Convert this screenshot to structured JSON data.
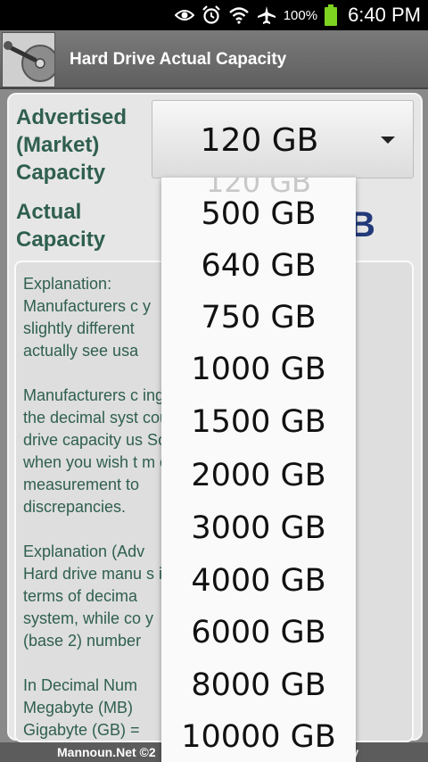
{
  "status_bar": {
    "battery_percent": "100%",
    "time": "6:40 PM",
    "icons": [
      "eye-icon",
      "alarm-icon",
      "wifi-icon",
      "airplane-icon",
      "battery-icon"
    ]
  },
  "app": {
    "title": "Hard Drive Actual Capacity"
  },
  "form": {
    "advertised_label": "Advertised\n(Market)\nCapacity",
    "actual_label": "Actual\nCapacity",
    "selected_capacity": "120 GB",
    "result_partial": "B"
  },
  "explanation": {
    "paragraphs": [
      "Explanation:\n Manufacturers c                    y\nslightly different                    \nactually see usa",
      "Manufacturers c                       ing\nthe decimal syst                      count\ndrive capacity us                      So,\nwhen you wish t                        m of\nmeasurement to\ndiscrepancies.",
      "Explanation (Adv\n Hard drive manu                       s in\nterms of decima\nsystem, while co                        y\n(base 2) number",
      "In Decimal Num\nMegabyte (MB)\nGigabyte (GB) ="
    ]
  },
  "dropdown": {
    "options": [
      "500 GB",
      "640 GB",
      "750 GB",
      "1000 GB",
      "1500 GB",
      "2000 GB",
      "3000 GB",
      "4000 GB",
      "6000 GB",
      "8000 GB",
      "10000 GB"
    ]
  },
  "footer": {
    "left_text": "Mannoun.Net ©2",
    "right_text": "ity"
  },
  "colors": {
    "label_green": "#2f5f4f",
    "result_blue": "#223a7a",
    "background_gray": "#8a8a8a"
  }
}
